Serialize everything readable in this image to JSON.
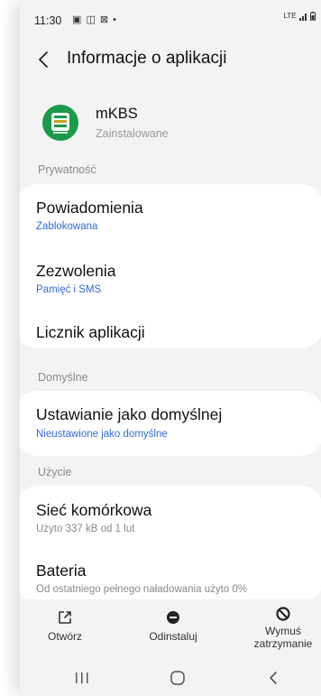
{
  "status_bar": {
    "time": "11:30",
    "icons": "▣ ◫ ⊠ •",
    "network": "LTE"
  },
  "app_bar": {
    "title": "Informacje o aplikacji"
  },
  "app": {
    "name": "mKBS",
    "status": "Zainstalowane"
  },
  "sections": {
    "privacy": "Prywatność",
    "defaults": "Domyślne",
    "usage": "Użycie"
  },
  "rows": {
    "notifications": {
      "title": "Powiadomienia",
      "subtitle": "Zablokowana"
    },
    "permissions": {
      "title": "Zezwolenia",
      "subtitle": "Pamięć i SMS"
    },
    "app_timer": {
      "title": "Licznik aplikacji"
    },
    "set_default": {
      "title": "Ustawianie jako domyślnej",
      "subtitle": "Nieustawione jako domyślne"
    },
    "mobile_data": {
      "title": "Sieć komórkowa",
      "subtitle": "Użyto 337 kB od 1 lut"
    },
    "battery": {
      "title": "Bateria",
      "subtitle": "Od ostatniego pełnego naładowania użyto 0%"
    }
  },
  "bottom_actions": {
    "open": "Otwórz",
    "uninstall": "Odinstaluj",
    "force_stop_line1": "Wymuś",
    "force_stop_line2": "zatrzymanie"
  },
  "colors": {
    "background": "#f3f3f3",
    "card": "#ffffff",
    "link_blue": "#2f6bd4",
    "app_logo_green": "#1b9a4b"
  }
}
